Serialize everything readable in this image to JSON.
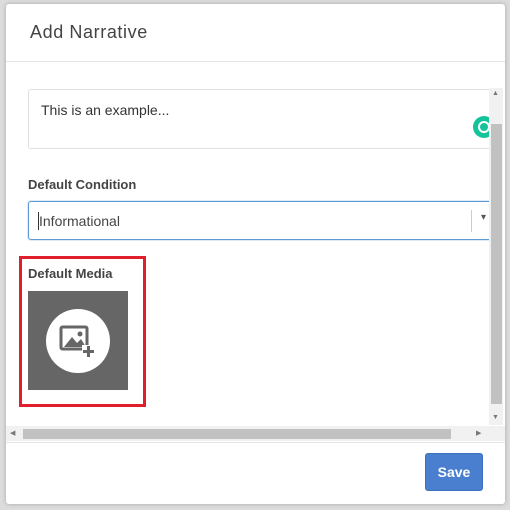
{
  "modal": {
    "title": "Add Narrative"
  },
  "narrative": {
    "text": "This is an example..."
  },
  "condition": {
    "label": "Default Condition",
    "selected": "Informational"
  },
  "media": {
    "label": "Default Media",
    "icon": "add-image-icon"
  },
  "footer": {
    "save_label": "Save"
  },
  "colors": {
    "accent": "#4a7fd0",
    "highlight": "#e01e2c",
    "media_tile": "#666666",
    "grammar_badge": "#15c39a"
  }
}
